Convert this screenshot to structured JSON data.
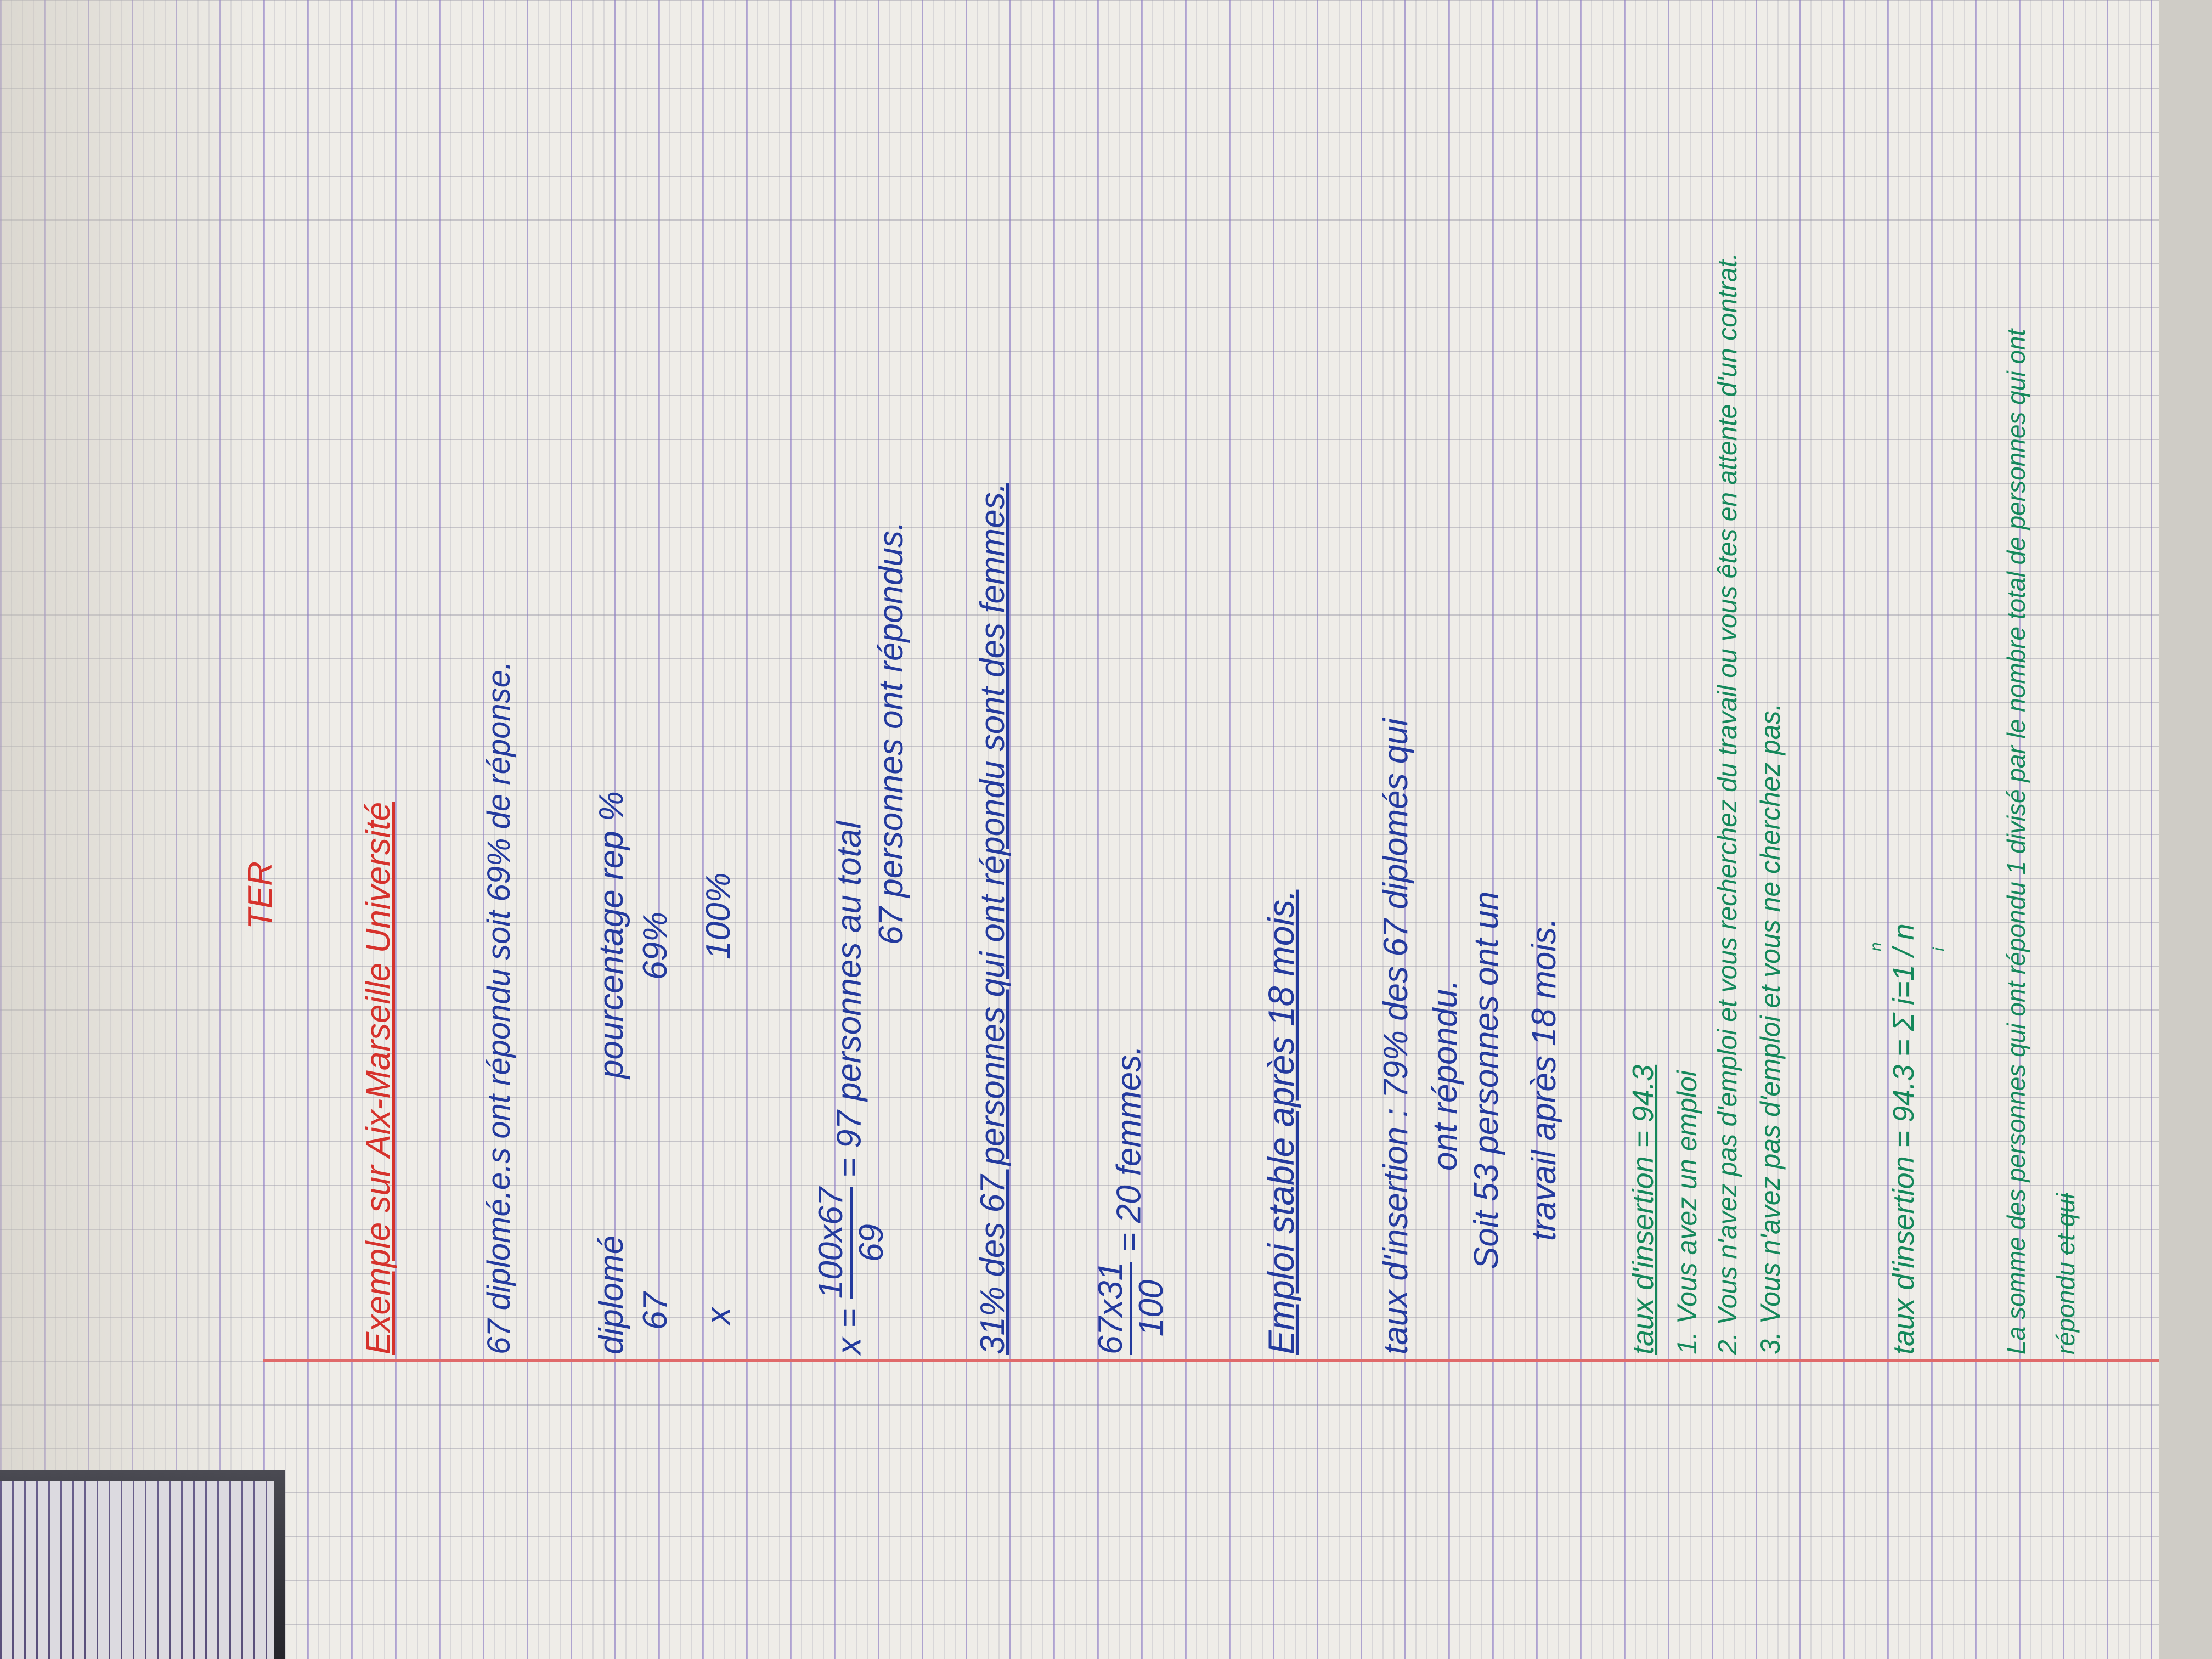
{
  "title": "TER",
  "heading": "Exemple sur Aix-Marseille Université",
  "line1": "67 diplomé.e.s ont répondu soit 69% de réponse.",
  "table": {
    "headers": [
      "diplomé",
      "pourcentage rep %"
    ],
    "rows": [
      [
        "67",
        "69%"
      ],
      [
        "x",
        "100%"
      ]
    ]
  },
  "calc1": {
    "lhs": "x =",
    "num": "100x67",
    "den": "69",
    "eq": "=",
    "result": "97 personnes au total",
    "note": "67 personnes ont répondus."
  },
  "line_women": "31% des 67 personnes qui ont répondu sont des femmes.",
  "calc2": {
    "num": "67x31",
    "den": "100",
    "result": "= 20 femmes."
  },
  "emploi": "Emploi stable après 18 mois.",
  "insertion": {
    "l1": "taux d'insertion : 79% des 67 diplomés qui",
    "l2": "ont répondu.",
    "l3": "Soit 53 personnes ont un",
    "l4": "travail après 18 mois."
  },
  "green": {
    "taux": "taux d'insertion = 94.3",
    "items": [
      "1. Vous avez un emploi",
      "2. Vous n'avez pas d'emploi et vous recherchez du travail ou vous êtes en attente d'un contrat.",
      "3. Vous n'avez pas d'emploi et vous ne cherchez pas."
    ],
    "formula": "taux d'insertion = 94.3 = Σ i=1 / n",
    "formula_top": "n",
    "formula_bottom": "i",
    "sentence1": "La somme des personnes qui ont répondu 1 divisé par le nombre total de personnes qui ont",
    "sentence2": "répondu",
    "sentence2_struck": "et qui"
  },
  "colors": {
    "red": "#d6322c",
    "blue": "#233a9e",
    "green": "#14885a"
  }
}
